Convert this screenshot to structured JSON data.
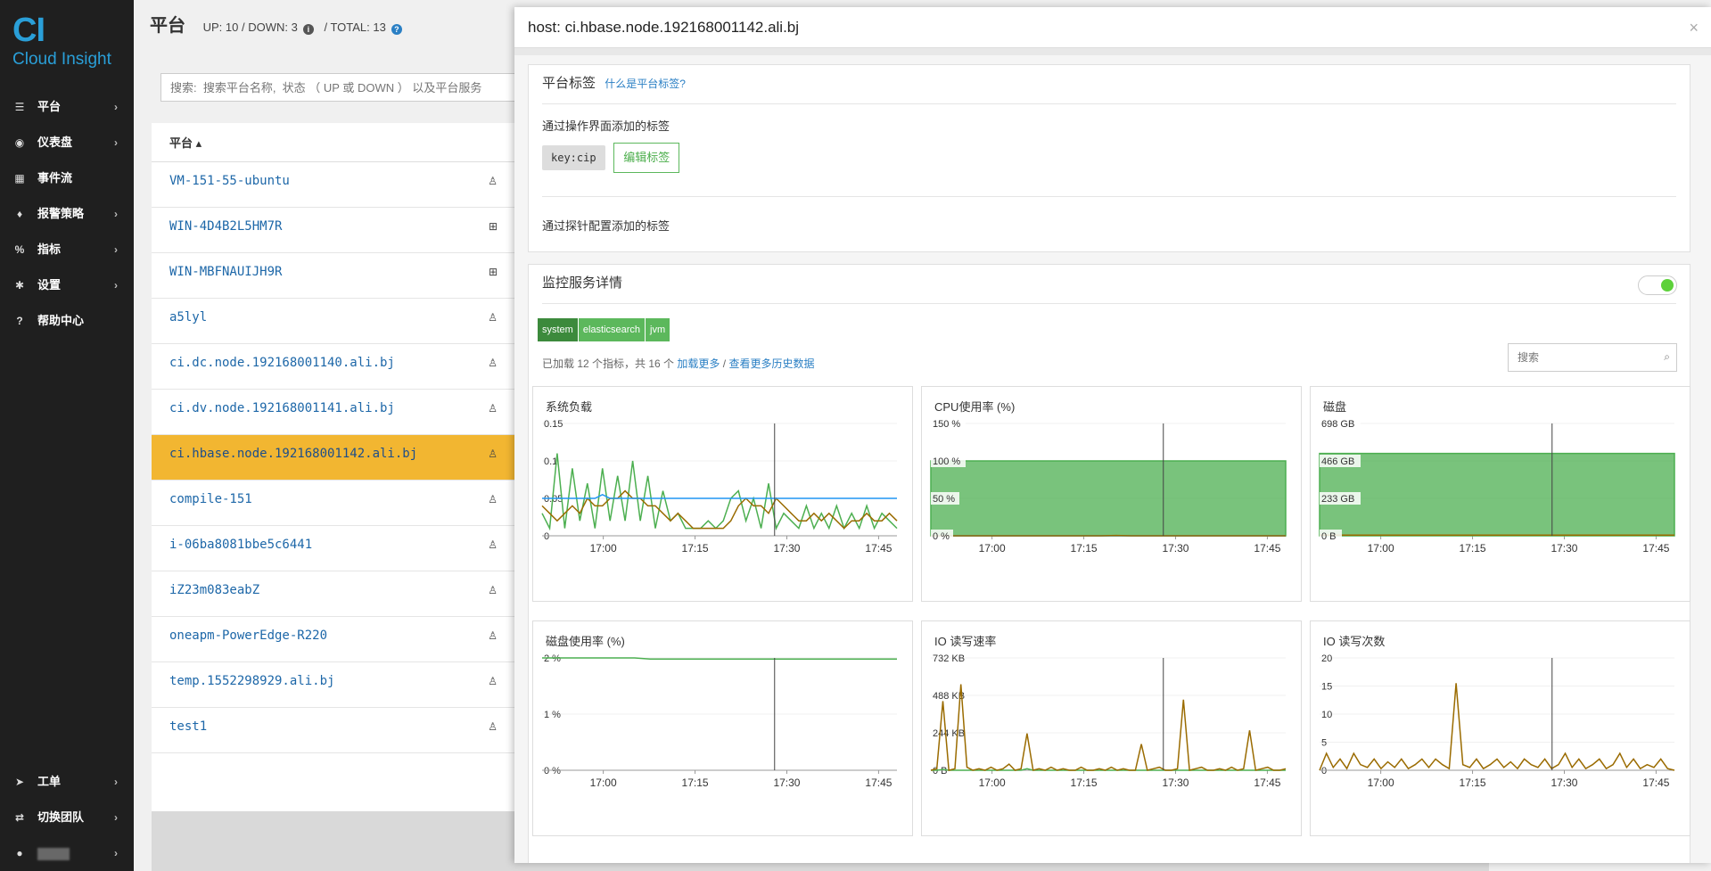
{
  "sidebar": {
    "logo_mark": "CI",
    "logo_name": "Cloud Insight",
    "items": [
      {
        "label": "平台",
        "icon": "server-icon"
      },
      {
        "label": "仪表盘",
        "icon": "dashboard-icon"
      },
      {
        "label": "事件流",
        "icon": "calendar-icon"
      },
      {
        "label": "报警策略",
        "icon": "bell-icon"
      },
      {
        "label": "指标",
        "icon": "percent-icon"
      },
      {
        "label": "设置",
        "icon": "gear-icon"
      },
      {
        "label": "帮助中心",
        "icon": "question-icon"
      }
    ],
    "bottom_items": [
      {
        "label": "工单",
        "icon": "send-icon"
      },
      {
        "label": "切换团队",
        "icon": "switch-icon"
      }
    ]
  },
  "header": {
    "title": "平台",
    "up_down": "UP: 10 / DOWN: 3",
    "total": "/ TOTAL: 13"
  },
  "search": {
    "placeholder": "搜索:  搜索平台名称,  状态 （ UP 或 DOWN ） 以及平台服务"
  },
  "list": {
    "header": "平台 ▴",
    "rows": [
      {
        "name": "VM-151-55-ubuntu",
        "os": "linux"
      },
      {
        "name": "WIN-4D4B2L5HM7R",
        "os": "windows"
      },
      {
        "name": "WIN-MBFNAUIJH9R",
        "os": "windows"
      },
      {
        "name": "a5lyl",
        "os": "linux"
      },
      {
        "name": "ci.dc.node.192168001140.ali.bj",
        "os": "linux"
      },
      {
        "name": "ci.dv.node.192168001141.ali.bj",
        "os": "linux"
      },
      {
        "name": "ci.hbase.node.192168001142.ali.bj",
        "os": "linux",
        "active": true
      },
      {
        "name": "compile-151",
        "os": "linux"
      },
      {
        "name": "i-06ba8081bbe5c6441",
        "os": "linux"
      },
      {
        "name": "iZ23m083eabZ",
        "os": "linux"
      },
      {
        "name": "oneapm-PowerEdge-R220",
        "os": "linux"
      },
      {
        "name": "temp.1552298929.ali.bj",
        "os": "linux"
      },
      {
        "name": "test1",
        "os": "linux"
      }
    ]
  },
  "panel": {
    "title": "host: ci.hbase.node.192168001142.ali.bj",
    "close": "×",
    "tags": {
      "title": "平台标签",
      "help": "什么是平台标签?",
      "ui_label": "通过操作界面添加的标签",
      "tag": "key:cip",
      "edit": "编辑标签",
      "probe_label": "通过探针配置添加的标签"
    },
    "services": {
      "title": "监控服务详情",
      "tabs": [
        "system",
        "elasticsearch",
        "jvm"
      ],
      "metric_info": "已加载 12 个指标，共 16 个",
      "load_more": "加载更多",
      "separator": "/",
      "history": "查看更多历史数据",
      "search_placeholder": "搜索"
    }
  },
  "chart_data": [
    {
      "type": "line",
      "title": "系统负载",
      "x_ticks": [
        "17:00",
        "17:15",
        "17:30",
        "17:45"
      ],
      "y_ticks": [
        "0",
        "0.05",
        "0.1",
        "0.15"
      ],
      "ylim": [
        0,
        0.15
      ],
      "cursor": "17:28",
      "series": [
        {
          "color": "#4caf50",
          "values": [
            0.03,
            0.01,
            0.11,
            0.01,
            0.09,
            0.02,
            0.07,
            0.01,
            0.09,
            0.02,
            0.08,
            0.02,
            0.1,
            0.02,
            0.08,
            0.01,
            0.06,
            0.02,
            0.03,
            0.01,
            0.01,
            0.01,
            0.02,
            0.01,
            0.02,
            0.05,
            0.06,
            0.02,
            0.05,
            0.01,
            0.07,
            0.01,
            0.03,
            0.02,
            0.01,
            0.04,
            0.01,
            0.03,
            0.01,
            0.04,
            0.01,
            0.03,
            0.01,
            0.04,
            0.01,
            0.03,
            0.02,
            0.01
          ]
        },
        {
          "color": "#9a6b00",
          "values": [
            0.04,
            0.03,
            0.02,
            0.03,
            0.04,
            0.03,
            0.05,
            0.04,
            0.04,
            0.05,
            0.05,
            0.06,
            0.05,
            0.05,
            0.04,
            0.04,
            0.03,
            0.02,
            0.03,
            0.02,
            0.01,
            0.01,
            0.01,
            0.01,
            0.01,
            0.02,
            0.04,
            0.05,
            0.04,
            0.04,
            0.03,
            0.05,
            0.04,
            0.03,
            0.02,
            0.02,
            0.03,
            0.02,
            0.03,
            0.02,
            0.01,
            0.02,
            0.02,
            0.03,
            0.02,
            0.02,
            0.03,
            0.02
          ]
        },
        {
          "color": "#2196f3",
          "values": [
            0.05,
            0.05,
            0.05,
            0.05,
            0.05,
            0.05,
            0.05,
            0.05,
            0.055,
            0.05,
            0.05,
            0.05,
            0.05,
            0.05,
            0.05,
            0.05,
            0.05,
            0.05,
            0.05,
            0.05,
            0.05,
            0.05,
            0.05,
            0.05,
            0.05,
            0.05,
            0.05,
            0.05,
            0.05,
            0.05,
            0.05,
            0.05,
            0.05,
            0.05,
            0.05,
            0.05,
            0.05,
            0.05,
            0.05,
            0.05,
            0.05,
            0.05,
            0.05,
            0.05,
            0.05,
            0.05,
            0.05,
            0.05
          ]
        }
      ]
    },
    {
      "type": "area",
      "title": "CPU使用率 (%)",
      "x_ticks": [
        "17:00",
        "17:15",
        "17:30",
        "17:45"
      ],
      "y_ticks": [
        "0 %",
        "50 %",
        "100 %",
        "150 %"
      ],
      "ylim": [
        0,
        150
      ],
      "cursor": "17:28",
      "series": [
        {
          "color": "#4caf50",
          "fill": true,
          "values": [
            100,
            100,
            100,
            100,
            100,
            100,
            100,
            100,
            100,
            100,
            100,
            100,
            100,
            100,
            100,
            100,
            100,
            100,
            100,
            100,
            100,
            100,
            100,
            100
          ]
        },
        {
          "color": "#2196f3",
          "values": [
            0,
            0,
            0,
            0,
            0,
            0,
            0,
            0,
            0,
            0,
            0,
            0,
            0,
            0,
            0,
            0,
            0,
            0,
            0,
            0,
            0,
            0,
            0,
            0
          ]
        },
        {
          "color": "#9a6b00",
          "values": [
            0,
            0,
            0,
            0,
            0,
            0,
            0,
            0,
            0,
            0,
            0,
            0,
            0.5,
            0,
            0,
            0,
            0,
            0,
            0,
            0,
            0,
            0,
            0,
            0
          ]
        }
      ]
    },
    {
      "type": "area",
      "title": "磁盘",
      "x_ticks": [
        "17:00",
        "17:15",
        "17:30",
        "17:45"
      ],
      "y_ticks": [
        "0 B",
        "233 GB",
        "466 GB",
        "698 GB"
      ],
      "ylim": [
        0,
        698
      ],
      "cursor": "17:28",
      "series": [
        {
          "color": "#4caf50",
          "fill": true,
          "values": [
            512,
            512,
            512,
            512,
            512,
            512,
            512,
            512,
            512,
            512,
            512,
            512,
            512,
            512,
            512,
            512,
            512,
            512,
            512,
            512,
            512,
            512,
            512,
            512
          ]
        },
        {
          "color": "#9a6b00",
          "values": [
            4,
            4,
            4,
            4,
            4,
            4,
            4,
            4,
            4,
            4,
            4,
            4,
            4,
            4,
            4,
            4,
            4,
            4,
            4,
            4,
            4,
            4,
            4,
            4
          ]
        }
      ]
    },
    {
      "type": "line",
      "title": "磁盘使用率 (%)",
      "x_ticks": [
        "17:00",
        "17:15",
        "17:30",
        "17:45"
      ],
      "y_ticks": [
        "0 %",
        "1 %",
        "2 %"
      ],
      "ylim": [
        0,
        2
      ],
      "cursor": "17:28",
      "series": [
        {
          "color": "#4caf50",
          "values": [
            2,
            2,
            2,
            2,
            2,
            2,
            2,
            1.98,
            1.98,
            1.98,
            1.98,
            1.98,
            1.98,
            1.98,
            1.98,
            1.98,
            1.98,
            1.98,
            1.98,
            1.98,
            1.98,
            1.98,
            1.98,
            1.98
          ]
        }
      ]
    },
    {
      "type": "line",
      "title": "IO 读写速率",
      "x_ticks": [
        "17:00",
        "17:15",
        "17:30",
        "17:45"
      ],
      "y_ticks": [
        "0 B",
        "244 KB",
        "488 KB",
        "732 KB"
      ],
      "ylim": [
        0,
        732
      ],
      "cursor": "17:28",
      "series": [
        {
          "color": "#4caf50",
          "values": [
            0,
            0,
            5,
            0,
            0,
            0,
            0,
            0,
            0,
            0,
            0,
            0,
            0,
            0,
            0,
            0,
            10,
            0,
            0,
            0,
            0,
            0,
            0,
            0,
            0,
            0,
            0,
            0,
            0,
            0,
            0,
            0,
            0,
            0,
            0,
            0,
            0,
            0,
            0,
            0,
            0,
            0,
            0,
            0,
            0,
            0,
            0,
            0,
            0,
            0,
            0,
            0,
            0,
            0,
            0,
            0,
            0,
            0,
            0,
            0
          ]
        },
        {
          "color": "#9a6b00",
          "values": [
            0,
            10,
            450,
            0,
            10,
            560,
            20,
            0,
            10,
            0,
            20,
            0,
            10,
            40,
            0,
            10,
            240,
            0,
            10,
            0,
            20,
            0,
            10,
            0,
            0,
            20,
            0,
            0,
            10,
            0,
            20,
            0,
            10,
            0,
            0,
            170,
            0,
            10,
            20,
            0,
            0,
            10,
            460,
            0,
            10,
            20,
            0,
            0,
            10,
            0,
            20,
            0,
            10,
            260,
            0,
            10,
            20,
            0,
            0,
            10
          ]
        }
      ]
    },
    {
      "type": "line",
      "title": "IO 读写次数",
      "x_ticks": [
        "17:00",
        "17:15",
        "17:30",
        "17:45"
      ],
      "y_ticks": [
        "0",
        "5",
        "10",
        "15",
        "20"
      ],
      "ylim": [
        0,
        20
      ],
      "cursor": "17:28",
      "series": [
        {
          "color": "#9a6b00",
          "values": [
            0,
            3,
            0.5,
            2,
            0.3,
            3,
            1,
            0.5,
            2,
            0.3,
            1.5,
            0.5,
            2,
            0.3,
            1,
            2,
            0.5,
            2,
            1,
            0.3,
            15.5,
            1,
            0.5,
            2,
            0.3,
            1,
            2,
            0.5,
            1.5,
            0.3,
            2,
            1,
            0.5,
            2,
            0.3,
            1,
            3,
            0.5,
            2,
            0.3,
            1,
            2,
            0.3,
            1,
            3,
            0.5,
            2,
            0.3,
            1,
            0.5,
            2,
            0.3,
            0
          ]
        }
      ]
    }
  ]
}
